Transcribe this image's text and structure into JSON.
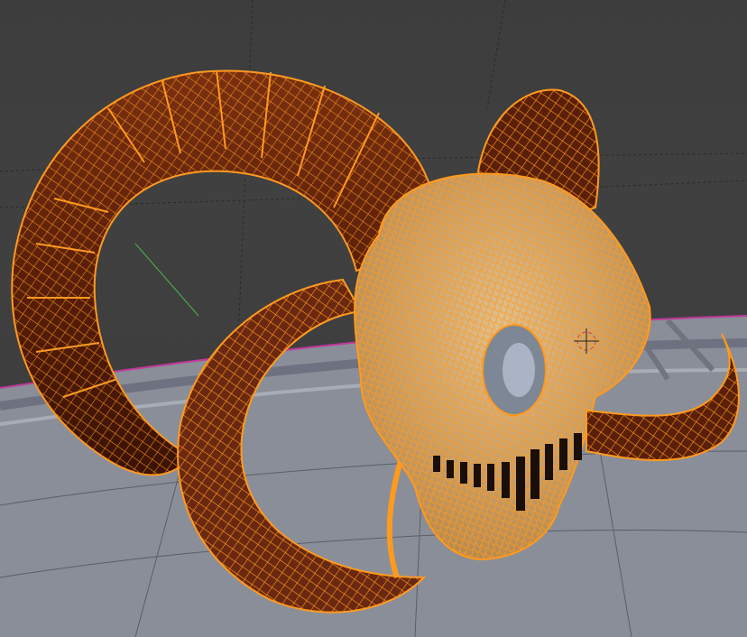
{
  "viewport": {
    "mode": "edit-mode-wireframe-overlay",
    "selection_color": "#ff9a1f",
    "background_color": "#3d3d3d",
    "floor_color": "#8a8e98",
    "platform_edge_color": "#c0399a",
    "horn_color": "#5a1f08",
    "skull_color": "#c8a87a"
  },
  "scene": {
    "objects": [
      {
        "name": "horn-left-large",
        "selected": true
      },
      {
        "name": "horn-right-small",
        "selected": true
      },
      {
        "name": "horn-tusk-left",
        "selected": true
      },
      {
        "name": "horn-tusk-right",
        "selected": true
      },
      {
        "name": "skull",
        "selected": true
      }
    ],
    "cursor": "3d-cursor",
    "axis_y_color": "#4caf50"
  }
}
